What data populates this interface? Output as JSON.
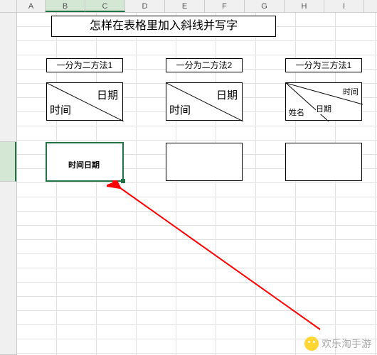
{
  "columns": [
    "A",
    "B",
    "C",
    "D",
    "E",
    "F",
    "G",
    "H",
    "I"
  ],
  "title": "怎样在表格里加入斜线并写字",
  "methods": {
    "m1": "一分为二方法1",
    "m2": "一分为二方法2",
    "m3": "一分为三方法1"
  },
  "diag1": {
    "top": "日期",
    "bottom": "时间"
  },
  "diag2": {
    "top": "日期",
    "bottom": "时间"
  },
  "diag3": {
    "a": "时间",
    "b": "日期",
    "c": "姓名"
  },
  "editing_cell": "时间日期",
  "watermark": "欢乐淘手游"
}
